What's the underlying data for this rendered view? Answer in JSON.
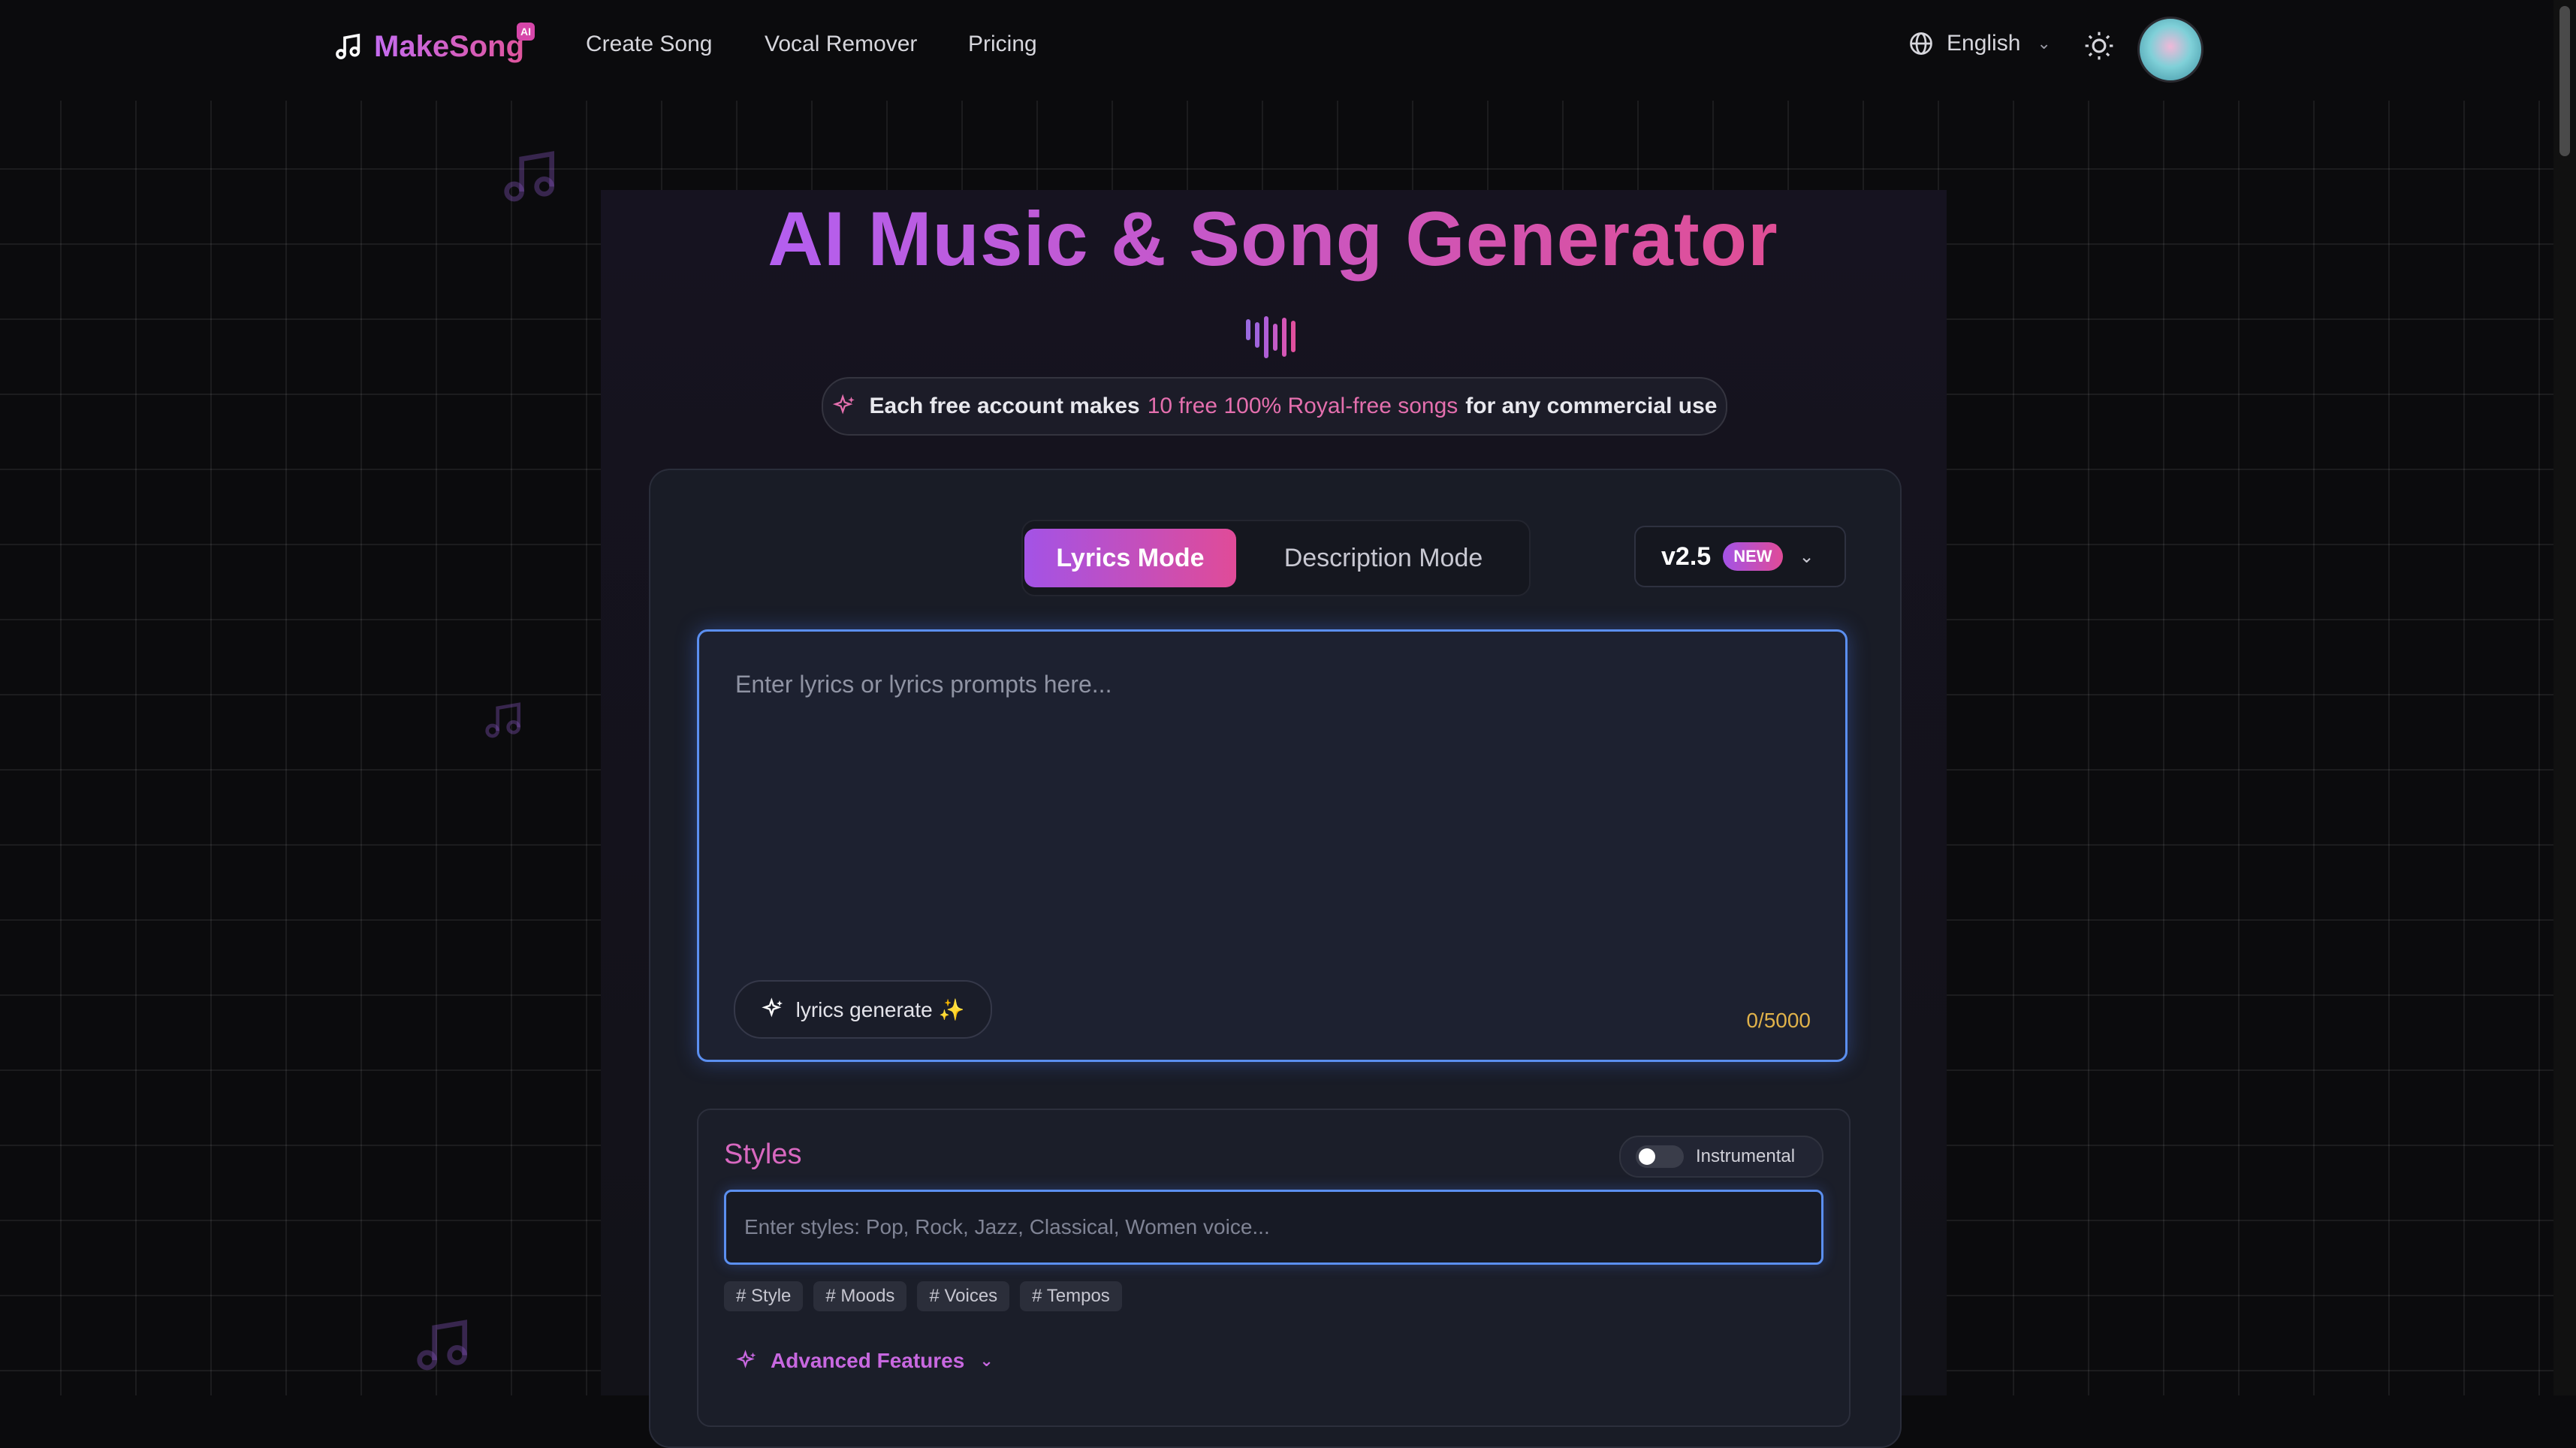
{
  "header": {
    "logo_text": "MakeSong",
    "logo_badge": "AI",
    "nav": [
      "Create Song",
      "Vocal Remover",
      "Pricing"
    ],
    "language": "English"
  },
  "hero": {
    "title": "AI Music & Song Generator",
    "promo_pre": "Each free account makes",
    "promo_highlight": "10 free 100% Royal-free songs",
    "promo_post": "for any commercial use"
  },
  "modes": {
    "active": "Lyrics Mode",
    "inactive": "Description Mode"
  },
  "version": {
    "label": "v2.5",
    "badge": "NEW"
  },
  "lyrics": {
    "placeholder": "Enter lyrics or lyrics prompts here...",
    "generate_label": "lyrics generate ✨",
    "counter": "0/5000"
  },
  "styles": {
    "title": "Styles",
    "instrumental_label": "Instrumental",
    "instrumental_on": false,
    "placeholder": "Enter styles: Pop, Rock, Jazz, Classical, Women voice...",
    "tags": [
      "# Style",
      "# Moods",
      "# Voices",
      "# Tempos"
    ],
    "advanced_label": "Advanced Features"
  },
  "colors": {
    "accent_purple": "#a353e6",
    "accent_pink": "#e04b98",
    "focus_blue": "#5b8ff0",
    "counter_gold": "#e0b24a"
  }
}
